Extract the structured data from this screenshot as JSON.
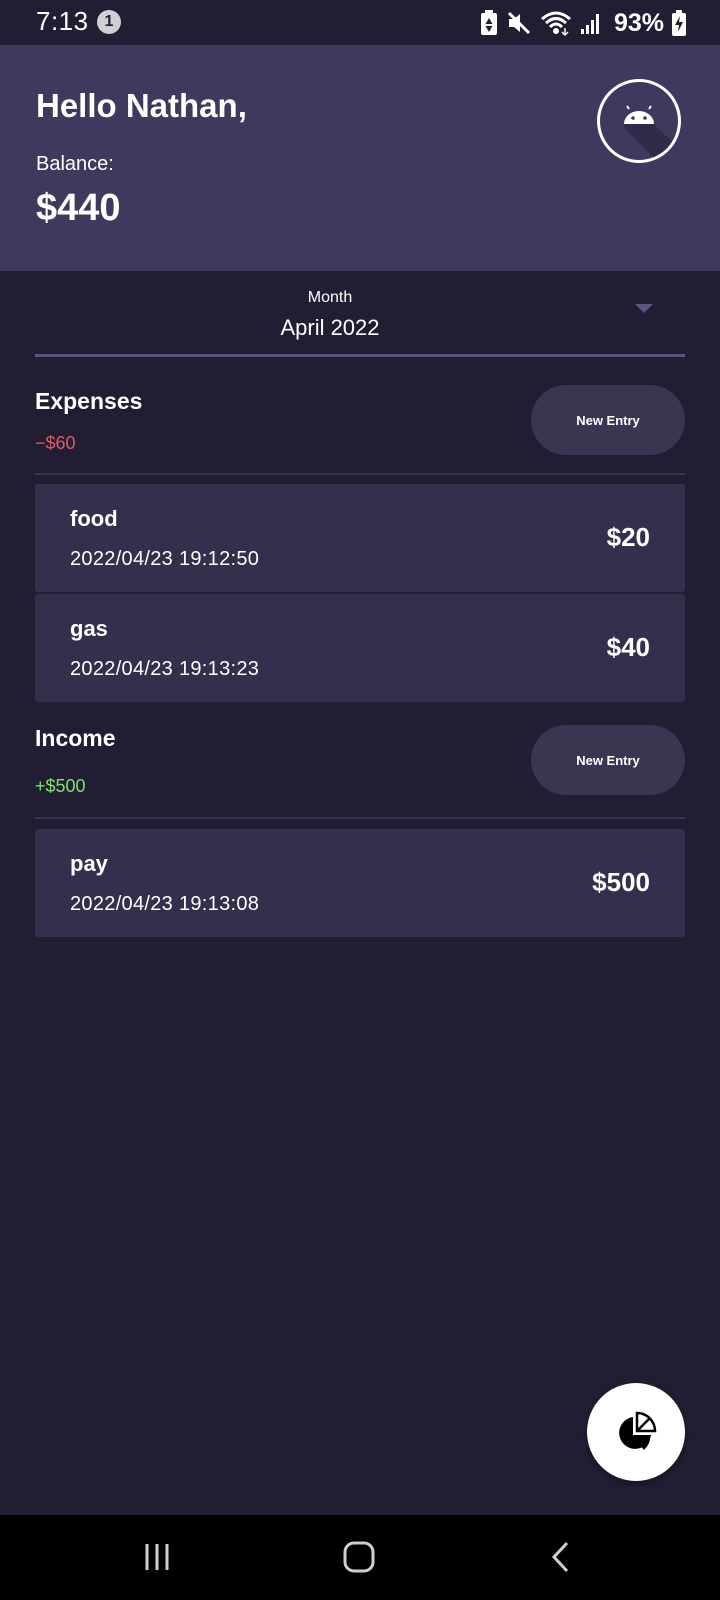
{
  "status_bar": {
    "time": "7:13",
    "notification_count": "1",
    "battery": "93%",
    "icons": [
      "battery-saver-icon",
      "mute-icon",
      "wifi-icon",
      "signal-icon",
      "charging-icon"
    ]
  },
  "header": {
    "greeting": "Hello Nathan,",
    "balance_label": "Balance:",
    "balance_value": "$440",
    "avatar_icon": "android-icon"
  },
  "month_selector": {
    "label": "Month",
    "value": "April 2022"
  },
  "expenses": {
    "title": "Expenses",
    "total": "−$60",
    "new_entry_label": "New Entry",
    "items": [
      {
        "name": "food",
        "date": "2022/04/23 19:12:50",
        "amount": "$20"
      },
      {
        "name": "gas",
        "date": "2022/04/23 19:13:23",
        "amount": "$40"
      }
    ]
  },
  "income": {
    "title": "Income",
    "total": "+$500",
    "new_entry_label": "New Entry",
    "items": [
      {
        "name": "pay",
        "date": "2022/04/23 19:13:08",
        "amount": "$500"
      }
    ]
  },
  "fab": {
    "icon": "pie-chart-icon"
  },
  "nav_bar": {
    "buttons": [
      "recent-apps-icon",
      "home-icon",
      "back-icon"
    ]
  },
  "colors": {
    "background": "#211d33",
    "header": "#41385d",
    "card": "#352e4d",
    "expense_total": "#e05a67",
    "income_total": "#7ee26b"
  }
}
